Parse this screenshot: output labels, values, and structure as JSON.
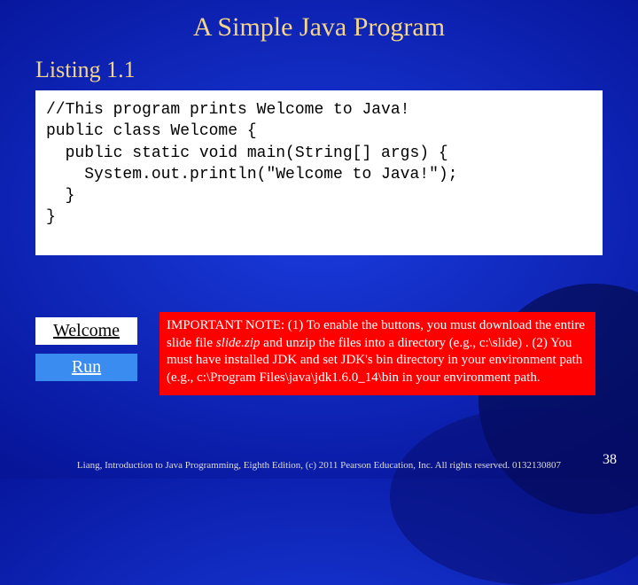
{
  "title": "A Simple Java Program",
  "subtitle": "Listing 1.1",
  "code": "//This program prints Welcome to Java! \npublic class Welcome { \n  public static void main(String[] args) { \n    System.out.println(\"Welcome to Java!\");\n  } \n}",
  "buttons": {
    "welcome": "Welcome",
    "run": "Run"
  },
  "note": {
    "prefix": "IMPORTANT NOTE: (1) To enable the buttons, you must download the entire slide file ",
    "slidefile": "slide.zip",
    "suffix": " and unzip the files into a directory (e.g., c:\\slide) . (2) You must have installed JDK and set JDK's bin directory in your environment path (e.g., c:\\Program Files\\java\\jdk1.6.0_14\\bin in your environment path."
  },
  "footer": "Liang, Introduction to Java Programming, Eighth Edition, (c) 2011 Pearson Education, Inc. All rights reserved. 0132130807",
  "page": "38"
}
